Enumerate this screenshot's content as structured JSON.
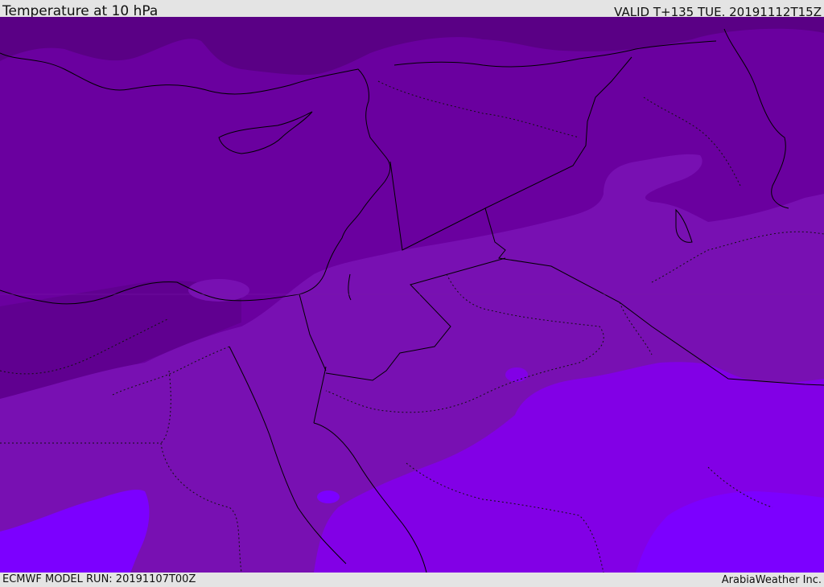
{
  "header": {
    "title": "Temperature at 10 hPa",
    "valid_time": "VALID T+135 TUE. 20191112T15Z"
  },
  "footer": {
    "model_run": "ECMWF MODEL RUN: 20191107T00Z",
    "credit": "ArabiaWeather Inc."
  },
  "colors": {
    "band_darkest": "#5a0085",
    "band_dark": "#6a009f",
    "band_mid": "#7810b2",
    "band_bright": "#8200e6",
    "band_brightest": "#7c00ff",
    "border_line": "#000000"
  }
}
